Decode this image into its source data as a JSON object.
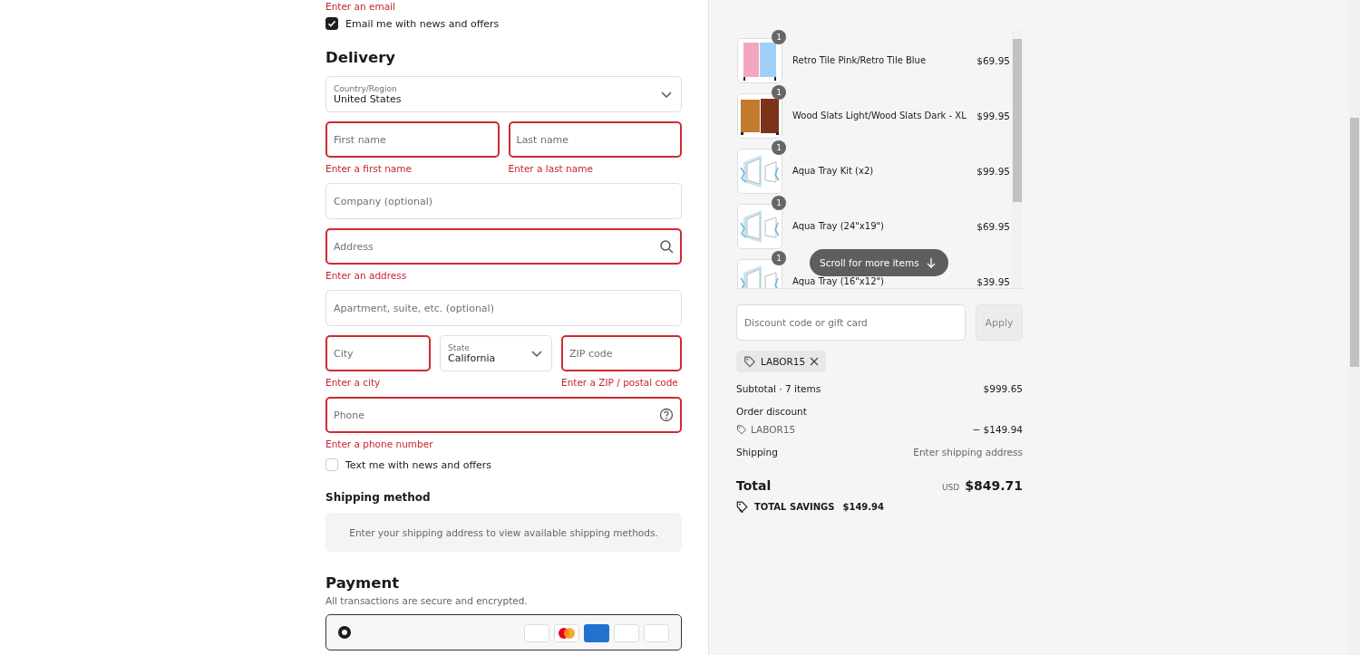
{
  "contact": {
    "error": "Enter an email",
    "newsletter": {
      "label": "Email me with news and offers",
      "checked": true
    }
  },
  "delivery": {
    "heading": "Delivery",
    "rows": [
      [
        {
          "kind": "select",
          "label": "Country/Region",
          "value": "United States"
        }
      ],
      [
        {
          "kind": "text",
          "placeholder": "First name",
          "invalid": true,
          "error": "Enter a first name"
        },
        {
          "kind": "text",
          "placeholder": "Last name",
          "invalid": true,
          "error": "Enter a last name"
        }
      ],
      [
        {
          "kind": "text",
          "placeholder": "Company (optional)",
          "invalid": false
        }
      ],
      [
        {
          "kind": "search",
          "placeholder": "Address",
          "invalid": true,
          "error": "Enter an address"
        }
      ],
      [
        {
          "kind": "text",
          "placeholder": "Apartment, suite, etc. (optional)",
          "invalid": false
        }
      ],
      [
        {
          "kind": "text",
          "placeholder": "City",
          "invalid": true,
          "error": "Enter a city"
        },
        {
          "kind": "select",
          "label": "State",
          "value": "California"
        },
        {
          "kind": "text",
          "placeholder": "ZIP code",
          "invalid": true,
          "error": "Enter a ZIP / postal code"
        }
      ],
      [
        {
          "kind": "help",
          "placeholder": "Phone",
          "invalid": true,
          "error": "Enter a phone number"
        }
      ]
    ],
    "sms": {
      "label": "Text me with news and offers",
      "checked": false
    }
  },
  "shipping_method": {
    "heading": "Shipping method",
    "notice": "Enter your shipping address to view available shipping methods."
  },
  "payment": {
    "heading": "Payment",
    "subtitle": "All transactions are secure and encrypted.",
    "option_selected": true
  },
  "cart": {
    "items": [
      {
        "name": "Retro Tile Pink/Retro Tile Blue",
        "price": "$69.95",
        "quantity": "1"
      },
      {
        "name": "Wood Slats Light/Wood Slats Dark - XL",
        "price": "$99.95",
        "quantity": "1"
      },
      {
        "name": "Aqua Tray Kit (x2)",
        "price": "$99.95",
        "quantity": "1"
      },
      {
        "name": "Aqua Tray (24\"x19\")",
        "price": "$69.95",
        "quantity": "1"
      },
      {
        "name": "Aqua Tray (16\"x12\")",
        "price": "$39.95",
        "quantity": "1"
      }
    ],
    "scroll_hint": "Scroll for more items"
  },
  "discount": {
    "placeholder": "Discount code or gift card",
    "button": "Apply",
    "applied_code": "LABOR15"
  },
  "summary": {
    "subtotal_label": "Subtotal · 7 items",
    "subtotal": "$999.65",
    "discount_label": "Order discount",
    "discount_code": "LABOR15",
    "discount_amount": "− $149.94",
    "shipping_label": "Shipping",
    "shipping_value": "Enter shipping address",
    "total_label": "Total",
    "currency": "USD",
    "total": "$849.71",
    "savings_label": "TOTAL SAVINGS",
    "savings": "$149.94"
  }
}
